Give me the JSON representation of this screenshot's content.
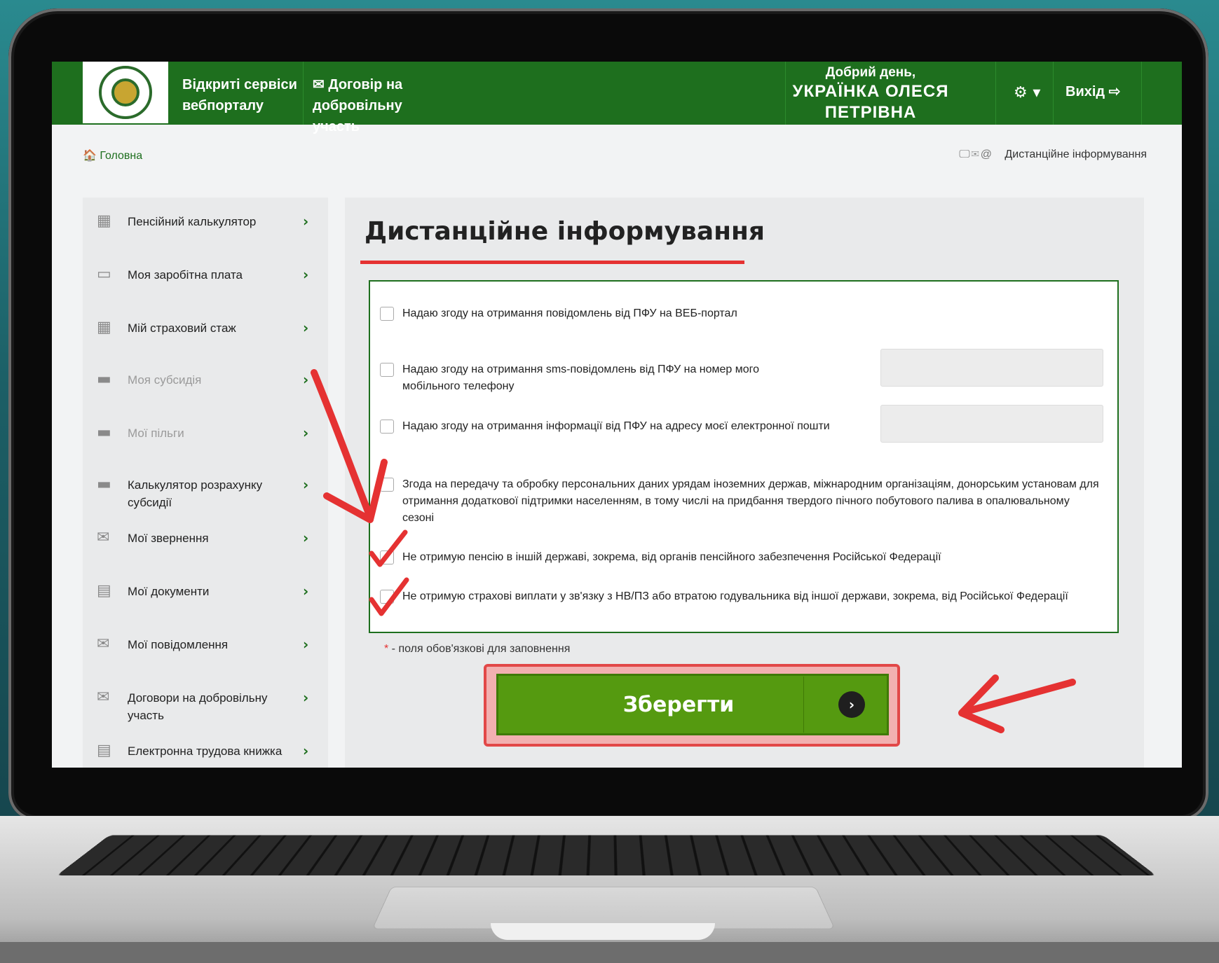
{
  "header": {
    "nav1": "Відкриті сервіси вебпорталу",
    "nav2_icon": "envelope-icon",
    "nav2": "Договір на добровільну участь",
    "greeting": "Добрий день,",
    "user_name": "УКРАЇНКА ОЛЕСЯ ПЕТРІВНА",
    "settings_icon": "⚙ ▾",
    "logout": "Вихід ⇨"
  },
  "breadcrumb": {
    "home": "🏠 Головна",
    "icons": "🖵✉@",
    "current": "Дистанційне інформування"
  },
  "sidebar": {
    "items": [
      {
        "label": "Пенсійний калькулятор",
        "icon": "▦",
        "muted": false
      },
      {
        "label": "Моя заробітна плата",
        "icon": "▭",
        "muted": false
      },
      {
        "label": "Мій страховий стаж",
        "icon": "▦",
        "muted": false
      },
      {
        "label": "Моя субсидія",
        "icon": "▬",
        "muted": true
      },
      {
        "label": "Мої пільги",
        "icon": "▬",
        "muted": true
      },
      {
        "label": "Калькулятор розрахунку субсидії",
        "icon": "▬",
        "muted": false
      },
      {
        "label": "Мої звернення",
        "icon": "✉",
        "muted": false
      },
      {
        "label": "Мої документи",
        "icon": "▤",
        "muted": false
      },
      {
        "label": "Мої повідомлення",
        "icon": "✉",
        "muted": false
      },
      {
        "label": "Договори на добровільну участь",
        "icon": "✉",
        "muted": false
      },
      {
        "label": "Електронна трудова книжка",
        "icon": "▤",
        "muted": false
      }
    ],
    "chevron": "›"
  },
  "main": {
    "title": "Дистанційне інформування",
    "options": [
      "Надаю згоду на отримання повідомлень від ПФУ на ВЕБ-портал",
      "Надаю згоду на отримання sms-повідомлень від ПФУ на номер мого мобільного телефону",
      "Надаю згоду на отримання інформації від ПФУ на адресу моєї електронної пошти",
      "Згода на передачу та обробку персональних даних урядам іноземних держав, міжнародним організаціям, донорським установам для отримання додаткової підтримки населенням, в тому числі на придбання твердого пічного побутового палива в опалювальному сезоні",
      "Не отримую пенсію в іншій державі, зокрема, від органів пенсійного забезпечення Російської Федерації",
      "Не отримую страхові виплати у зв'язку з НВ/ПЗ або втратою годувальника від іншої держави, зокрема, від Російської Федерації"
    ],
    "required_star": "*",
    "required_note": " - поля обов'язкові для заповнення",
    "save_label": "Зберегти",
    "save_chevron": "›"
  },
  "colors": {
    "brand_green": "#1e6f1e",
    "save_green": "#559a10",
    "annotation_red": "#e53232"
  }
}
